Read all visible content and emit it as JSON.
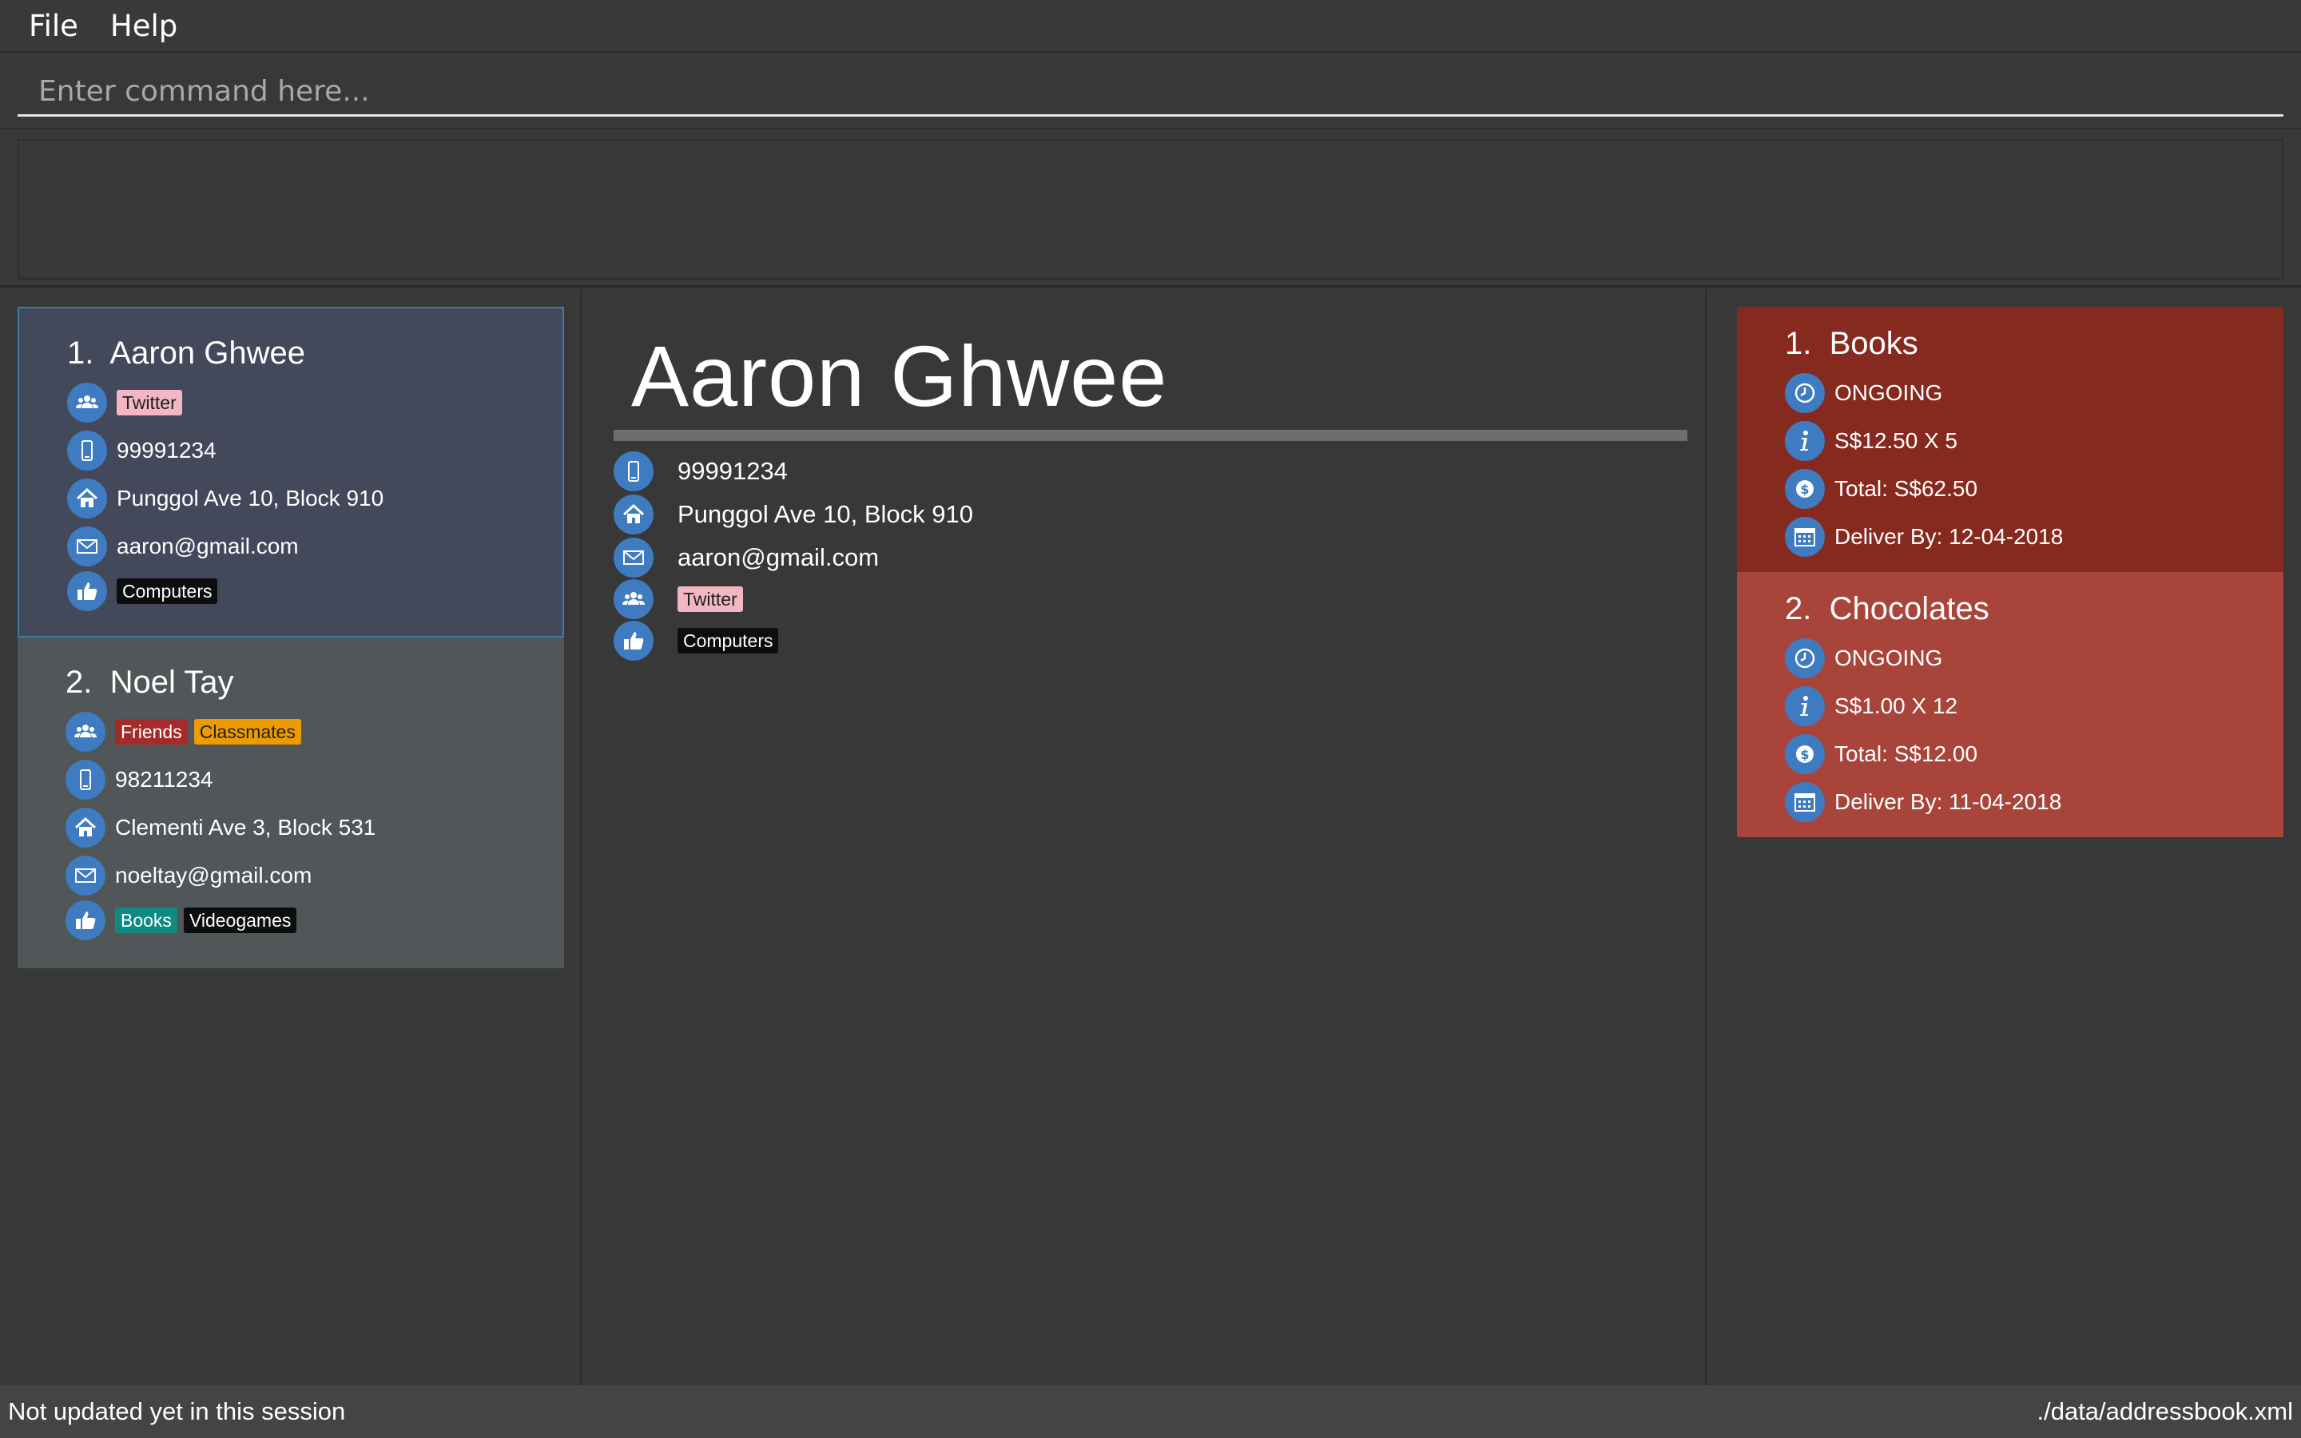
{
  "menu": {
    "file": "File",
    "help": "Help"
  },
  "command": {
    "placeholder": "Enter command here...",
    "value": ""
  },
  "result": {
    "text": ""
  },
  "persons": [
    {
      "index": "1.",
      "name": "Aaron Ghwee",
      "groups": [
        "Twitter"
      ],
      "phone": "99991234",
      "address": "Punggol Ave 10, Block 910",
      "email": "aaron@gmail.com",
      "preferences": [
        "Computers"
      ],
      "selected": true
    },
    {
      "index": "2.",
      "name": "Noel Tay",
      "groups": [
        "Friends",
        "Classmates"
      ],
      "phone": "98211234",
      "address": "Clementi Ave 3, Block 531",
      "email": "noeltay@gmail.com",
      "preferences": [
        "Books",
        "Videogames"
      ],
      "selected": false
    }
  ],
  "detail": {
    "name": "Aaron Ghwee",
    "phone": "99991234",
    "address": "Punggol Ave 10, Block 910",
    "email": "aaron@gmail.com",
    "groups": [
      "Twitter"
    ],
    "preferences": [
      "Computers"
    ]
  },
  "orders": [
    {
      "index": "1.",
      "name": "Books",
      "status": "ONGOING",
      "price_qty": "S$12.50 X 5",
      "total": "Total: S$62.50",
      "deliver": "Deliver By: 12-04-2018"
    },
    {
      "index": "2.",
      "name": "Chocolates",
      "status": "ONGOING",
      "price_qty": "S$1.00 X 12",
      "total": "Total: S$12.00",
      "deliver": "Deliver By: 11-04-2018"
    }
  ],
  "status": {
    "left": "Not updated yet in this session",
    "right": "./data/addressbook.xml"
  },
  "colors": {
    "background": "#383838",
    "icon_blue": "#3e7bc0",
    "selected_card": "#43495a",
    "order_first": "#862a1f",
    "order_second": "#a9443b"
  }
}
